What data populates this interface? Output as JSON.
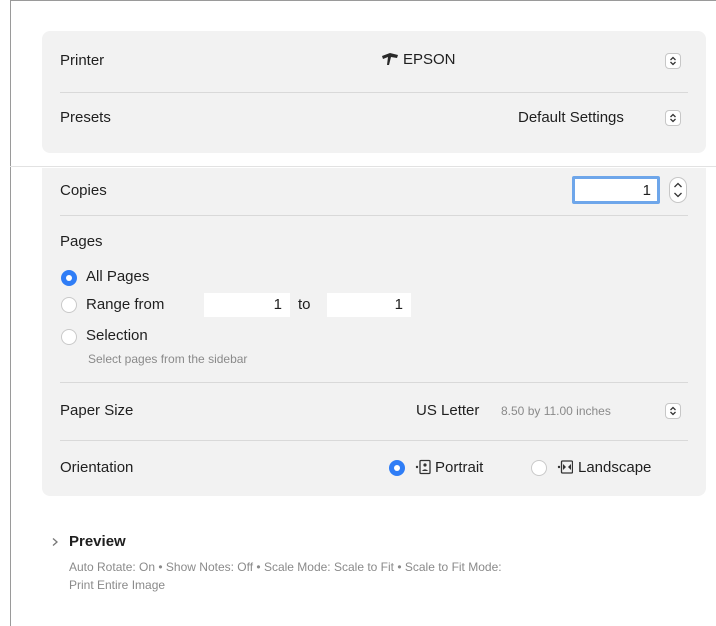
{
  "printer": {
    "label": "Printer",
    "value": "EPSON",
    "icon": "printer-icon"
  },
  "presets": {
    "label": "Presets",
    "value": "Default Settings"
  },
  "copies": {
    "label": "Copies",
    "value": "1"
  },
  "pages": {
    "label": "Pages",
    "all_pages": "All Pages",
    "range_from": "Range from",
    "range_start": "1",
    "to": "to",
    "range_end": "1",
    "selection": "Selection",
    "selection_hint": "Select pages from the sidebar",
    "selected": "all_pages"
  },
  "paper_size": {
    "label": "Paper Size",
    "value": "US Letter",
    "detail": "8.50 by 11.00 inches"
  },
  "orientation": {
    "label": "Orientation",
    "portrait": "Portrait",
    "landscape": "Landscape",
    "selected": "portrait"
  },
  "preview": {
    "label": "Preview",
    "summary_line1": "Auto Rotate: On • Show Notes: Off • Scale Mode: Scale to Fit • Scale to Fit Mode:",
    "summary_line2": "Print Entire Image"
  },
  "colors": {
    "accent": "#2f7df6",
    "focus_ring": "#6ea6ea",
    "card_background": "#f2f2f2"
  }
}
